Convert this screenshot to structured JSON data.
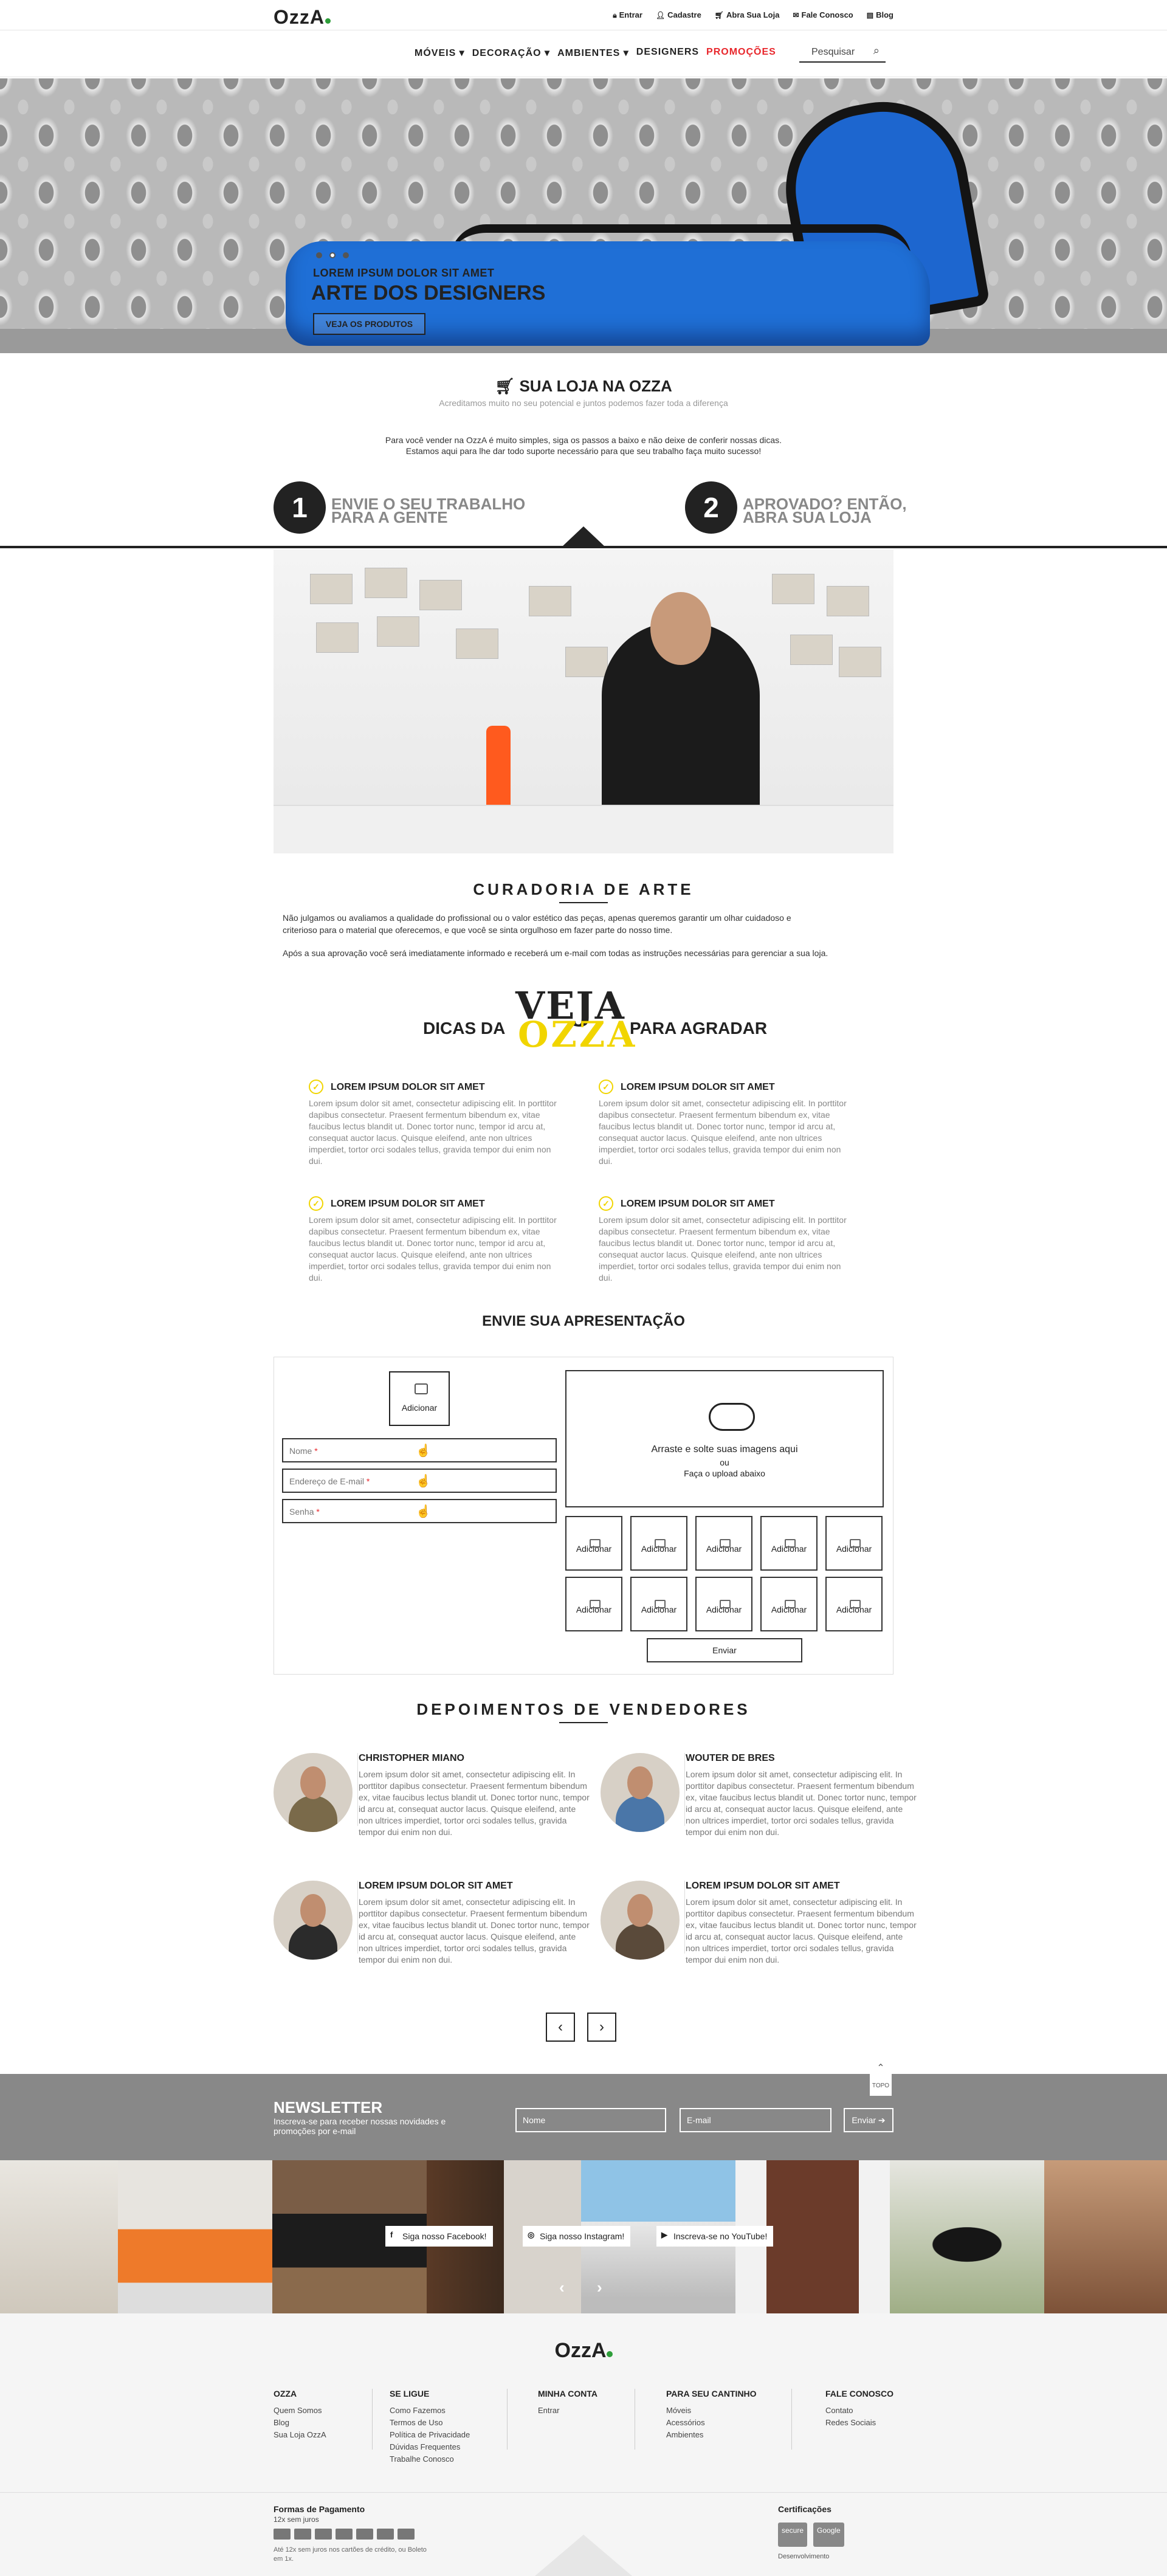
{
  "header": {
    "logo": "OzzA",
    "links": [
      {
        "icon": "lock-icon",
        "label": "Entrar"
      },
      {
        "icon": "user-icon",
        "label": "Cadastre"
      },
      {
        "icon": "cart-icon",
        "label": "Abra Sua Loja"
      },
      {
        "icon": "chat-icon",
        "label": "Fale Conosco"
      },
      {
        "icon": "document-icon",
        "label": "Blog"
      }
    ]
  },
  "nav": {
    "items": [
      "MÓVEIS ▾",
      "DECORAÇÃO ▾",
      "AMBIENTES ▾",
      "DESIGNERS"
    ],
    "promo": "PROMOÇÕES",
    "search_placeholder": "Pesquisar",
    "promo_color": "#e8262b"
  },
  "hero": {
    "subtitle": "LOREM IPSUM DOLOR SIT AMET",
    "title": "ARTE DOS DESIGNERS",
    "button": "VEJA OS PRODUTOS",
    "slides": 3,
    "active_slide": 2
  },
  "shop": {
    "title": "SUA LOJA NA OZZA",
    "subtitle": "Acreditamos muito no seu potencial e juntos podemos fazer toda a diferença",
    "intro1": "Para você vender na OzzA é muito simples, siga os passos a baixo e não deixe de conferir nossas dicas.",
    "intro2": "Estamos aqui para lhe dar todo suporte necessário para que seu trabalho faça muito sucesso!",
    "step1": {
      "number": "1",
      "line1": "ENVIE O SEU TRABALHO",
      "line2": "PARA A GENTE"
    },
    "step2": {
      "number": "2",
      "line1": "APROVADO? ENTÃO,",
      "line2": "ABRA SUA LOJA"
    }
  },
  "curadoria": {
    "title": "CURADORIA DE ARTE",
    "p1a": "Não julgamos ou avaliamos a qualidade do profissional ou o valor estético das peças, apenas queremos garantir um olhar cuidadoso e",
    "p1b": "criterioso para o material que oferecemos, e que você se sinta orgulhoso em fazer parte do nosso time.",
    "p2": "Após a sua aprovação você será imediatamente informado e receberá um e-mail com todas as instruções necessárias para gerenciar a sua loja."
  },
  "dicas": {
    "veja": "VEJA",
    "ozza": "OZZA",
    "left": "DICAS DA",
    "right": "PARA AGRADAR",
    "accent": "#f1d500",
    "items": [
      {
        "title": "LOREM IPSUM DOLOR SIT AMET",
        "text": "Lorem ipsum dolor sit amet, consectetur adipiscing elit. In porttitor dapibus consectetur. Praesent fermentum bibendum ex, vitae faucibus lectus blandit ut. Donec tortor nunc, tempor id arcu at, consequat auctor lacus. Quisque eleifend, ante non ultrices imperdiet, tortor orci sodales tellus, gravida tempor dui enim non dui."
      },
      {
        "title": "LOREM IPSUM DOLOR SIT AMET",
        "text": "Lorem ipsum dolor sit amet, consectetur adipiscing elit. In porttitor dapibus consectetur. Praesent fermentum bibendum ex, vitae faucibus lectus blandit ut. Donec tortor nunc, tempor id arcu at, consequat auctor lacus. Quisque eleifend, ante non ultrices imperdiet, tortor orci sodales tellus, gravida tempor dui enim non dui."
      },
      {
        "title": "LOREM IPSUM DOLOR SIT AMET",
        "text": "Lorem ipsum dolor sit amet, consectetur adipiscing elit. In porttitor dapibus consectetur. Praesent fermentum bibendum ex, vitae faucibus lectus blandit ut. Donec tortor nunc, tempor id arcu at, consequat auctor lacus. Quisque eleifend, ante non ultrices imperdiet, tortor orci sodales tellus, gravida tempor dui enim non dui."
      },
      {
        "title": "LOREM IPSUM DOLOR SIT AMET",
        "text": "Lorem ipsum dolor sit amet, consectetur adipiscing elit. In porttitor dapibus consectetur. Praesent fermentum bibendum ex, vitae faucibus lectus blandit ut. Donec tortor nunc, tempor id arcu at, consequat auctor lacus. Quisque eleifend, ante non ultrices imperdiet, tortor orci sodales tellus, gravida tempor dui enim non dui."
      }
    ]
  },
  "form": {
    "title": "ENVIE SUA APRESENTAÇÃO",
    "avatar_label": "Adicionar",
    "name_placeholder": "Nome",
    "email_placeholder": "Endereço de E-mail",
    "password_placeholder": "Senha",
    "required_mark": "*",
    "drop_line1": "Arraste e solte suas imagens aqui",
    "drop_line2": "ou",
    "drop_line3": "Faça o upload abaixo",
    "slot_label": "Adicionar",
    "submit": "Enviar"
  },
  "depoimentos": {
    "title": "DEPOIMENTOS DE VENDEDORES",
    "items": [
      {
        "name": "CHRISTOPHER MIANO",
        "text": "Lorem ipsum dolor sit amet, consectetur adipiscing elit. In porttitor dapibus consectetur. Praesent fermentum bibendum ex, vitae faucibus lectus blandit ut. Donec tortor nunc, tempor id arcu at, consequat auctor lacus. Quisque eleifend, ante non ultrices imperdiet, tortor orci sodales tellus, gravida tempor dui enim non dui."
      },
      {
        "name": "WOUTER DE BRES",
        "text": "Lorem ipsum dolor sit amet, consectetur adipiscing elit. In porttitor dapibus consectetur. Praesent fermentum bibendum ex, vitae faucibus lectus blandit ut. Donec tortor nunc, tempor id arcu at, consequat auctor lacus. Quisque eleifend, ante non ultrices imperdiet, tortor orci sodales tellus, gravida tempor dui enim non dui."
      },
      {
        "name": "LOREM IPSUM DOLOR SIT AMET",
        "text": "Lorem ipsum dolor sit amet, consectetur adipiscing elit. In porttitor dapibus consectetur. Praesent fermentum bibendum ex, vitae faucibus lectus blandit ut. Donec tortor nunc, tempor id arcu at, consequat auctor lacus. Quisque eleifend, ante non ultrices imperdiet, tortor orci sodales tellus, gravida tempor dui enim non dui."
      },
      {
        "name": "LOREM IPSUM DOLOR SIT AMET",
        "text": "Lorem ipsum dolor sit amet, consectetur adipiscing elit. In porttitor dapibus consectetur. Praesent fermentum bibendum ex, vitae faucibus lectus blandit ut. Donec tortor nunc, tempor id arcu at, consequat auctor lacus. Quisque eleifend, ante non ultrices imperdiet, tortor orci sodales tellus, gravida tempor dui enim non dui."
      }
    ],
    "prev": "‹",
    "next": "›"
  },
  "newsletter": {
    "top_label": "TOPO",
    "title": "NEWSLETTER",
    "subtitle": "Inscreva-se para receber nossas novidades e promoções por e-mail",
    "name_placeholder": "Nome",
    "email_placeholder": "E-mail",
    "button": "Enviar ➔"
  },
  "social": {
    "facebook": "Siga nosso Facebook!",
    "instagram": "Siga nosso Instagram!",
    "youtube": "Inscreva-se no YouTube!",
    "prev": "‹",
    "next": "›"
  },
  "footer": {
    "logo": "OzzA",
    "columns": [
      {
        "title": "OZZA",
        "links": [
          "Quem Somos",
          "Blog",
          "Sua Loja OzzA"
        ]
      },
      {
        "title": "SE LIGUE",
        "links": [
          "Como Fazemos",
          "Termos de Uso",
          "Política de Privacidade",
          "Dúvidas Frequentes",
          "Trabalhe Conosco"
        ]
      },
      {
        "title": "MINHA CONTA",
        "links": [
          "Entrar"
        ]
      },
      {
        "title": "PARA SEU CANTINHO",
        "links": [
          "Móveis",
          "Acessórios",
          "Ambientes"
        ]
      },
      {
        "title": "FALE CONOSCO",
        "links": [
          "Contato",
          "Redes Sociais"
        ]
      }
    ],
    "payment_title": "Formas de Pagamento",
    "payment_installments": "12x sem juros",
    "payment_note": "Até 12x sem juros nos cartões de crédito, ou Boleto em 1x.",
    "cert_title": "Certificações",
    "cert_seals": [
      "secure",
      "Google"
    ],
    "developer": "Desenvolvimento"
  }
}
